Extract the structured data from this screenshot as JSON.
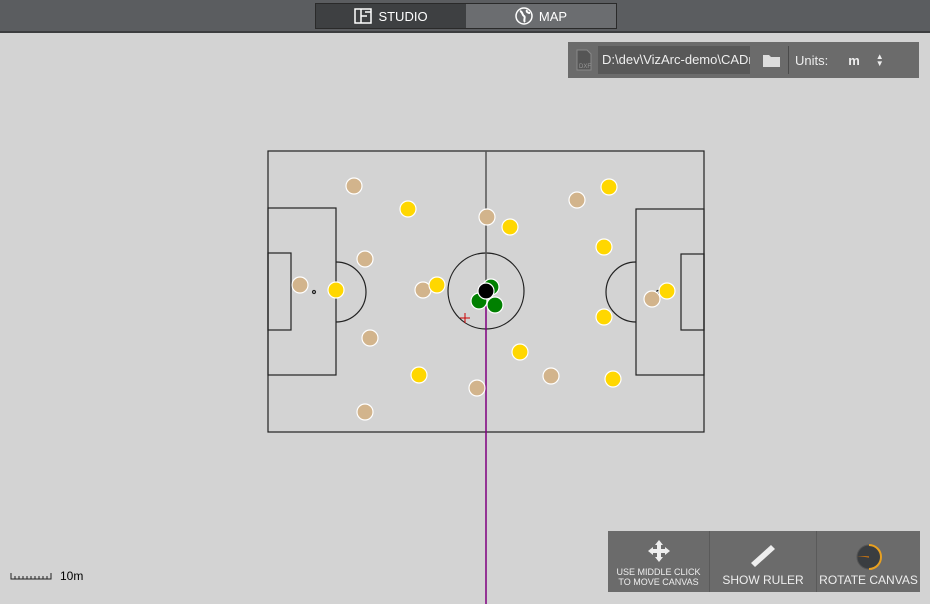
{
  "tabs": [
    {
      "label": "STUDIO",
      "icon": "floorplan-icon",
      "active": true
    },
    {
      "label": "MAP",
      "icon": "globe-icon",
      "active": false
    }
  ],
  "file": {
    "path": "D:\\dev\\VizArc-demo\\CADmaps\\",
    "units_label": "Units:",
    "units_value": "m"
  },
  "tools": {
    "move": "USE MIDDLE CLICK\nTO MOVE CANVAS",
    "move1": "USE MIDDLE CLICK",
    "move2": "TO MOVE CANVAS",
    "ruler": "SHOW RULER",
    "rotate": "ROTATE CANVAS"
  },
  "scale": {
    "label": "10m"
  },
  "colors": {
    "team_a": "#d2b48c",
    "team_b": "#ffd700",
    "referees": "#008000",
    "ball": "#000000",
    "axis": "#800080",
    "accent": "#e8a020"
  }
}
